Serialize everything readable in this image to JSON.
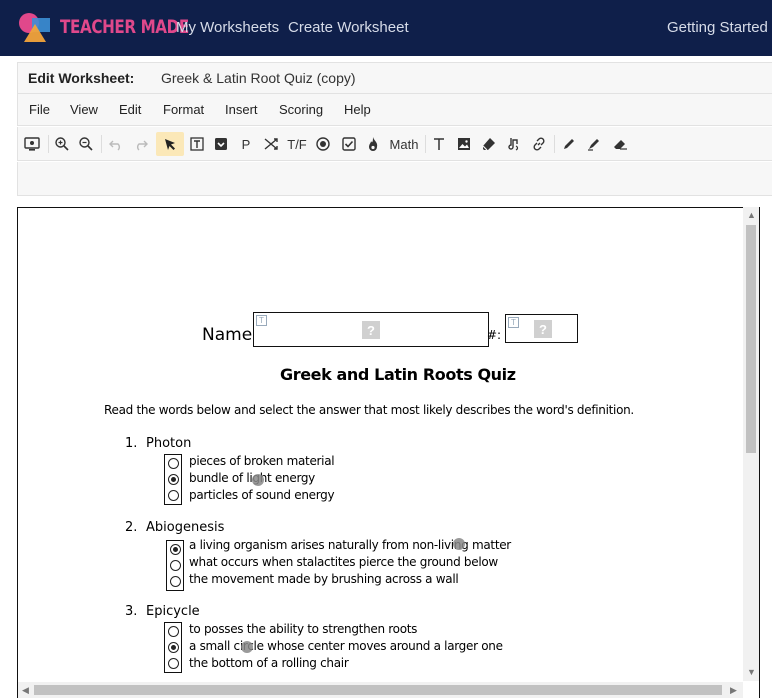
{
  "app": {
    "logo_text": "TEACHER MADE",
    "nav": [
      "My Worksheets",
      "Create Worksheet"
    ],
    "getting_started": "Getting Started",
    "brand_color": "#0f1f4a",
    "logo_text_color": "#e0488b"
  },
  "editor": {
    "label": "Edit Worksheet:",
    "title": "Greek & Latin Root Quiz (copy)"
  },
  "menu": [
    "File",
    "View",
    "Edit",
    "Format",
    "Insert",
    "Scoring",
    "Help"
  ],
  "toolbar": {
    "icons": [
      "preview-icon",
      "zoom-in-icon",
      "zoom-out-icon",
      "undo-icon",
      "redo-icon",
      "select-pointer-icon",
      "text-box-icon",
      "dropdown-icon",
      "paragraph-icon",
      "match-icon",
      "true-false-icon",
      "multiple-choice-icon",
      "checkbox-icon",
      "fire-icon",
      "text-tool-icon",
      "image-icon",
      "eraser-icon",
      "audio-icon",
      "link-icon",
      "pen-icon",
      "highlighter-icon",
      "whiteout-icon"
    ],
    "p_label": "P",
    "tf_label": "T/F",
    "math_label": "Math"
  },
  "worksheet": {
    "name_label": "Name:",
    "hash_label": "#:",
    "field_placeholder": "?",
    "title": "Greek and Latin Roots Quiz",
    "instructions": "Read the words below and select the answer that most likely describes the word's definition.",
    "questions": [
      {
        "number": "1.",
        "term": "Photon",
        "options": [
          "pieces of broken material",
          "bundle of light energy",
          "particles of sound energy"
        ],
        "selected": 1
      },
      {
        "number": "2.",
        "term": "Abiogenesis",
        "options": [
          "a living organism arises naturally from non-living matter",
          "what occurs when stalactites pierce the ground below",
          "the movement made by brushing across a wall"
        ],
        "selected": 0
      },
      {
        "number": "3.",
        "term": "Epicycle",
        "options": [
          "to posses the ability to strengthen roots",
          "a small circle whose center moves around a larger one",
          "the bottom of a rolling chair"
        ],
        "selected": 1
      }
    ]
  }
}
